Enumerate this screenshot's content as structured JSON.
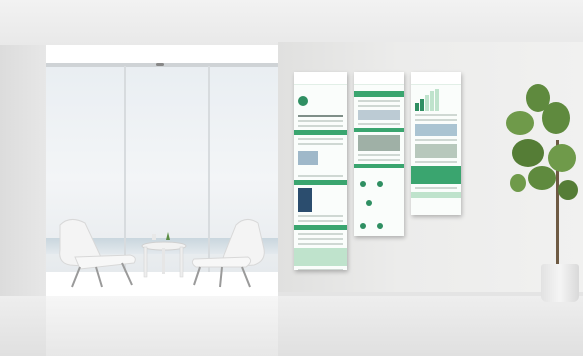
{
  "scene": {
    "description_type": "photo-mockup",
    "colors": {
      "poster_accent": "#3aa56f",
      "wall": "#ececeb",
      "floor": "#e4e4e4",
      "foliage": "#5f8a3e"
    }
  },
  "posters": [
    {
      "logo": "",
      "title": ""
    },
    {
      "logo": "",
      "title": ""
    },
    {
      "logo": "",
      "title": ""
    }
  ]
}
